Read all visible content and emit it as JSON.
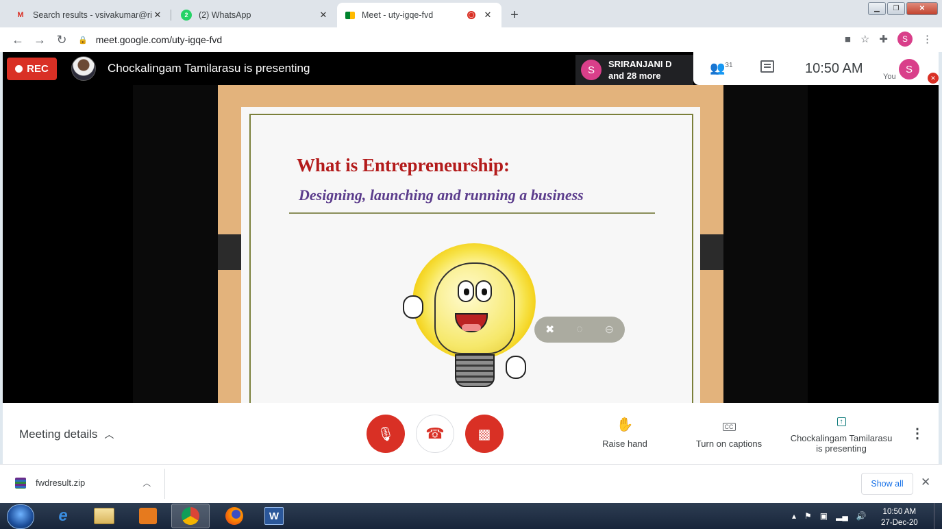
{
  "browser": {
    "tabs": [
      {
        "title": "Search results - vsivakumar@ritr",
        "favicon": "gmail-icon",
        "favicon_color": "#d93025"
      },
      {
        "title": "(2) WhatsApp",
        "favicon": "whatsapp-icon",
        "favicon_color": "#25d366"
      },
      {
        "title": "Meet - uty-igqe-fvd",
        "favicon": "meet-icon",
        "favicon_color": "#00832d",
        "active": true,
        "recording": true
      }
    ],
    "url": "meet.google.com/uty-igqe-fvd",
    "profile_initial": "S"
  },
  "meet": {
    "rec_label": "REC",
    "presenting_text": "Chockalingam Tamilarasu is presenting",
    "speaker": {
      "initial": "S",
      "name": "SRIRANJANI D",
      "more": "and 28 more"
    },
    "participants_count": "31",
    "time": "10:50 AM",
    "you_label": "You",
    "you_initial": "S"
  },
  "slide": {
    "title": "What is Entrepreneurship:",
    "subtitle": "Designing, launching and running a business"
  },
  "controls": {
    "meeting_details": "Meeting details",
    "raise_hand": "Raise hand",
    "captions": "Turn on captions",
    "presenting_line1": "Chockalingam Tamilarasu",
    "presenting_line2": "is presenting"
  },
  "downloads": {
    "file": "fwdresult.zip",
    "show_all": "Show all"
  },
  "taskbar": {
    "time": "10:50 AM",
    "date": "27-Dec-20"
  },
  "colors": {
    "meet_red": "#d93025",
    "avatar_pink": "#d93f8a",
    "slide_title": "#b31b1b",
    "slide_subtitle": "#5b3c8c"
  }
}
